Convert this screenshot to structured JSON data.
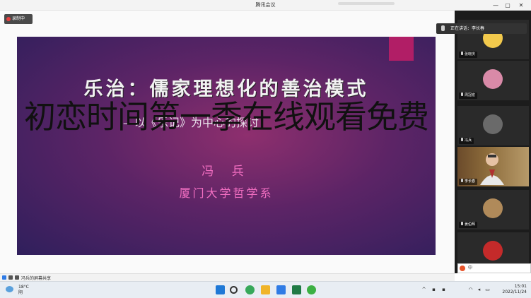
{
  "window": {
    "title": "腾讯会议",
    "controls": [
      "—",
      "▢",
      "✕"
    ]
  },
  "recording": {
    "label": "录制中"
  },
  "slide": {
    "title": "乐治：儒家理想化的善治模式",
    "subtitle": "—以《乐记》为中心的探讨",
    "author": "冯 兵",
    "affiliation": "厦门大学哲学系"
  },
  "overlay_text": "初恋时间第一季在线观看免费",
  "speaking": {
    "label": "正在讲话：李长春"
  },
  "participants": [
    {
      "name": "张晓庆",
      "avatar_color": "#f2c94c",
      "video": false
    },
    {
      "name": "周冠宏",
      "avatar_color": "#d98aa8",
      "video": false
    },
    {
      "name": "冯兵",
      "avatar_color": "#6a6a6a",
      "video": false
    },
    {
      "name": "李长春",
      "avatar_color": "#c9a27a",
      "video": true
    },
    {
      "name": "姜伯辉",
      "avatar_color": "#b08a5a",
      "video": false
    },
    {
      "name": "",
      "avatar_color": "#c42a2a",
      "video": false
    }
  ],
  "share_status": {
    "label": "冯兵的屏幕共享"
  },
  "ime": {
    "label": "中"
  },
  "taskbar": {
    "weather_temp": "18°C",
    "weather_cond": "阴",
    "time": "15:01",
    "date": "2022/11/24",
    "apps": [
      {
        "name": "windows-start-icon",
        "color": "#1e78d6"
      },
      {
        "name": "search-icon",
        "color": "#333333"
      },
      {
        "name": "edge-icon",
        "color": "#36a85a"
      },
      {
        "name": "file-explorer-icon",
        "color": "#f0b429"
      },
      {
        "name": "tencent-meeting-icon",
        "color": "#2f7be5"
      },
      {
        "name": "excel-icon",
        "color": "#1f7a45"
      },
      {
        "name": "wechat-icon",
        "color": "#3cb043"
      }
    ]
  }
}
